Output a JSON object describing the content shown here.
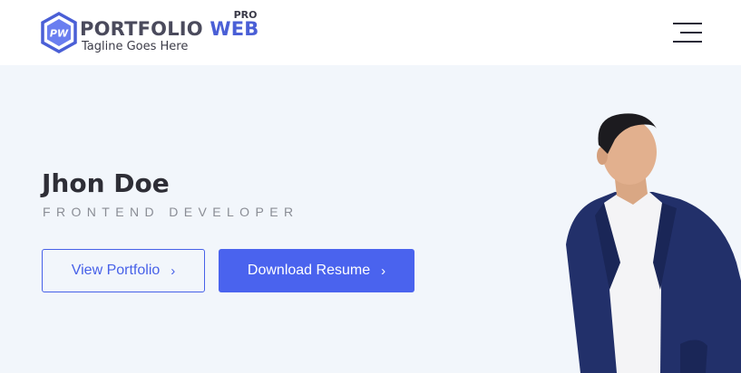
{
  "brand": {
    "mark_text": "PW",
    "name_part1": "PORTFOLIO",
    "name_part2": "WEB",
    "badge": "PRO",
    "tagline": "Tagline Goes Here",
    "colors": {
      "primary": "#4a63ee",
      "dark": "#4a4a5c"
    }
  },
  "header": {
    "menu_icon": "hamburger-menu-icon"
  },
  "hero": {
    "name": "Jhon Doe",
    "role": "FRONTEND DEVELOPER",
    "buttons": [
      {
        "label": "View Portfolio",
        "icon": "chevron-right-icon"
      },
      {
        "label": "Download Resume",
        "icon": "chevron-right-icon"
      }
    ],
    "photo": "man-in-suit-portrait"
  }
}
